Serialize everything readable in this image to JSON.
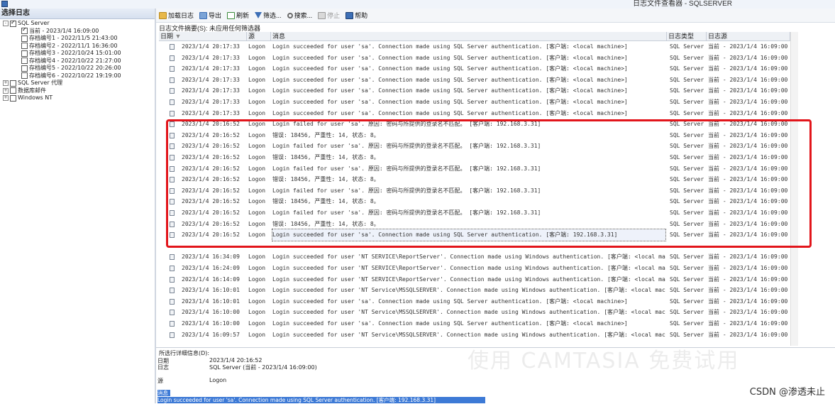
{
  "window": {
    "title": "日志文件查看器 - SQLSERVER"
  },
  "left_pane": {
    "title": "选择日志",
    "tree": [
      {
        "label": "SQL Server",
        "level": 0,
        "checked": true,
        "expander": "-"
      },
      {
        "label": "当前 - 2023/1/4 16:09:00",
        "level": 1,
        "checked": true
      },
      {
        "label": "存档编号1 - 2022/11/5 21:43:00",
        "level": 1,
        "checked": false
      },
      {
        "label": "存档编号2 - 2022/11/1 16:36:00",
        "level": 1,
        "checked": false
      },
      {
        "label": "存档编号3 - 2022/10/24 15:01:00",
        "level": 1,
        "checked": false
      },
      {
        "label": "存档编号4 - 2022/10/22 21:27:00",
        "level": 1,
        "checked": false
      },
      {
        "label": "存档编号5 - 2022/10/22 20:26:00",
        "level": 1,
        "checked": false
      },
      {
        "label": "存档编号6 - 2022/10/22 19:19:00",
        "level": 1,
        "checked": false
      },
      {
        "label": "SQL Server 代理",
        "level": 0,
        "checked": false,
        "expander": "+"
      },
      {
        "label": "数据库邮件",
        "level": 0,
        "checked": false,
        "expander": "+"
      },
      {
        "label": "Windows NT",
        "level": 0,
        "checked": false,
        "expander": "+"
      }
    ]
  },
  "toolbar": {
    "load": "加载日志",
    "export": "导出",
    "refresh": "刷新",
    "filter": "筛选...",
    "search": "搜索...",
    "stop": "停止",
    "help": "帮助"
  },
  "summary": "日志文件摘要(S): 未应用任何筛选器",
  "grid": {
    "columns": {
      "date": "日期",
      "source": "源",
      "message": "消息",
      "log_type": "日志类型",
      "log_source": "日志源"
    },
    "rows": [
      {
        "date": "2023/1/4 20:17:33",
        "source": "Logon",
        "message": "Login succeeded for user 'sa'. Connection made using SQL Server authentication. [客户端: <local machine>]",
        "type": "SQL Server",
        "log": "当前 - 2023/1/4 16:09:00"
      },
      {
        "date": "2023/1/4 20:17:33",
        "source": "Logon",
        "message": "Login succeeded for user 'sa'. Connection made using SQL Server authentication. [客户端: <local machine>]",
        "type": "SQL Server",
        "log": "当前 - 2023/1/4 16:09:00"
      },
      {
        "date": "2023/1/4 20:17:33",
        "source": "Logon",
        "message": "Login succeeded for user 'sa'. Connection made using SQL Server authentication. [客户端: <local machine>]",
        "type": "SQL Server",
        "log": "当前 - 2023/1/4 16:09:00"
      },
      {
        "date": "2023/1/4 20:17:33",
        "source": "Logon",
        "message": "Login succeeded for user 'sa'. Connection made using SQL Server authentication. [客户端: <local machine>]",
        "type": "SQL Server",
        "log": "当前 - 2023/1/4 16:09:00"
      },
      {
        "date": "2023/1/4 20:17:33",
        "source": "Logon",
        "message": "Login succeeded for user 'sa'. Connection made using SQL Server authentication. [客户端: <local machine>]",
        "type": "SQL Server",
        "log": "当前 - 2023/1/4 16:09:00"
      },
      {
        "date": "2023/1/4 20:17:33",
        "source": "Logon",
        "message": "Login succeeded for user 'sa'. Connection made using SQL Server authentication. [客户端: <local machine>]",
        "type": "SQL Server",
        "log": "当前 - 2023/1/4 16:09:00"
      },
      {
        "date": "2023/1/4 20:17:33",
        "source": "Logon",
        "message": "Login succeeded for user 'sa'. Connection made using SQL Server authentication. [客户端: <local machine>]",
        "type": "SQL Server",
        "log": "当前 - 2023/1/4 16:09:00"
      },
      {
        "date": "2023/1/4 20:16:52",
        "source": "Logon",
        "message": "Login failed for user 'sa'. 原因: 密码与所提供的登录名不匹配。 [客户端: 192.168.3.31]",
        "type": "SQL Server",
        "log": "当前 - 2023/1/4 16:09:00"
      },
      {
        "date": "2023/1/4 20:16:52",
        "source": "Logon",
        "message": "错误: 18456, 严重性: 14, 状态: 8。",
        "type": "SQL Server",
        "log": "当前 - 2023/1/4 16:09:00"
      },
      {
        "date": "2023/1/4 20:16:52",
        "source": "Logon",
        "message": "Login failed for user 'sa'. 原因: 密码与所提供的登录名不匹配。 [客户端: 192.168.3.31]",
        "type": "SQL Server",
        "log": "当前 - 2023/1/4 16:09:00"
      },
      {
        "date": "2023/1/4 20:16:52",
        "source": "Logon",
        "message": "错误: 18456, 严重性: 14, 状态: 8。",
        "type": "SQL Server",
        "log": "当前 - 2023/1/4 16:09:00"
      },
      {
        "date": "2023/1/4 20:16:52",
        "source": "Logon",
        "message": "Login failed for user 'sa'. 原因: 密码与所提供的登录名不匹配。 [客户端: 192.168.3.31]",
        "type": "SQL Server",
        "log": "当前 - 2023/1/4 16:09:00"
      },
      {
        "date": "2023/1/4 20:16:52",
        "source": "Logon",
        "message": "错误: 18456, 严重性: 14, 状态: 8。",
        "type": "SQL Server",
        "log": "当前 - 2023/1/4 16:09:00"
      },
      {
        "date": "2023/1/4 20:16:52",
        "source": "Logon",
        "message": "Login failed for user 'sa'. 原因: 密码与所提供的登录名不匹配。 [客户端: 192.168.3.31]",
        "type": "SQL Server",
        "log": "当前 - 2023/1/4 16:09:00"
      },
      {
        "date": "2023/1/4 20:16:52",
        "source": "Logon",
        "message": "错误: 18456, 严重性: 14, 状态: 8。",
        "type": "SQL Server",
        "log": "当前 - 2023/1/4 16:09:00"
      },
      {
        "date": "2023/1/4 20:16:52",
        "source": "Logon",
        "message": "Login failed for user 'sa'. 原因: 密码与所提供的登录名不匹配。 [客户端: 192.168.3.31]",
        "type": "SQL Server",
        "log": "当前 - 2023/1/4 16:09:00"
      },
      {
        "date": "2023/1/4 20:16:52",
        "source": "Logon",
        "message": "错误: 18456, 严重性: 14, 状态: 8。",
        "type": "SQL Server",
        "log": "当前 - 2023/1/4 16:09:00"
      },
      {
        "date": "2023/1/4 20:16:52",
        "source": "Logon",
        "message": "Login succeeded for user 'sa'. Connection made using SQL Server authentication. [客户端: 192.168.3.31]",
        "type": "SQL Server",
        "log": "当前 - 2023/1/4 16:09:00",
        "selected": true
      },
      {
        "date": "",
        "source": "",
        "message": "",
        "type": "",
        "log": ""
      },
      {
        "date": "2023/1/4 16:34:09",
        "source": "Logon",
        "message": "Login succeeded for user 'NT SERVICE\\ReportServer'. Connection made using Windows authentication. [客户端: <local machi",
        "type": "SQL Server",
        "log": "当前 - 2023/1/4 16:09:00"
      },
      {
        "date": "2023/1/4 16:24:09",
        "source": "Logon",
        "message": "Login succeeded for user 'NT SERVICE\\ReportServer'. Connection made using Windows authentication. [客户端: <local machi",
        "type": "SQL Server",
        "log": "当前 - 2023/1/4 16:09:00"
      },
      {
        "date": "2023/1/4 16:14:09",
        "source": "Logon",
        "message": "Login succeeded for user 'NT SERVICE\\ReportServer'. Connection made using Windows authentication. [客户端: <local machi",
        "type": "SQL Server",
        "log": "当前 - 2023/1/4 16:09:00"
      },
      {
        "date": "2023/1/4 16:10:01",
        "source": "Logon",
        "message": "Login succeeded for user 'NT Service\\MSSQLSERVER'. Connection made using Windows authentication. [客户端: <local machine>]",
        "type": "SQL Server",
        "log": "当前 - 2023/1/4 16:09:00"
      },
      {
        "date": "2023/1/4 16:10:01",
        "source": "Logon",
        "message": "Login succeeded for user 'sa'. Connection made using SQL Server authentication. [客户端: <local machine>]",
        "type": "SQL Server",
        "log": "当前 - 2023/1/4 16:09:00"
      },
      {
        "date": "2023/1/4 16:10:00",
        "source": "Logon",
        "message": "Login succeeded for user 'NT Service\\MSSQLSERVER'. Connection made using Windows authentication. [客户端: <local machine>]",
        "type": "SQL Server",
        "log": "当前 - 2023/1/4 16:09:00"
      },
      {
        "date": "2023/1/4 16:10:00",
        "source": "Logon",
        "message": "Login succeeded for user 'sa'. Connection made using SQL Server authentication. [客户端: <local machine>]",
        "type": "SQL Server",
        "log": "当前 - 2023/1/4 16:09:00"
      },
      {
        "date": "2023/1/4 16:09:57",
        "source": "Logon",
        "message": "Login succeeded for user 'NT Service\\MSSQLSERVER'. Connection made using Windows authentication. [客户端: <local machine>]",
        "type": "SQL Server",
        "log": "当前 - 2023/1/4 16:09:00"
      }
    ]
  },
  "details": {
    "header": "所选行详细信息(D):",
    "date_label": "日期",
    "date_value": "2023/1/4 20:16:52",
    "log_label": "日志",
    "log_value": "SQL Server (当前 - 2023/1/4 16:09:00)",
    "source_label": "源",
    "source_value": "Logon",
    "message_label": "消息",
    "message_value": "Login succeeded for user 'sa'. Connection made using SQL Server authentication. [客户端: 192.168.3.31]"
  },
  "watermark": "使用 CAMTASIA 免费试用",
  "credit": "CSDN @渗透未止",
  "colors": {
    "highlight_box": "#e2151b",
    "selection": "#3d7ad6"
  }
}
